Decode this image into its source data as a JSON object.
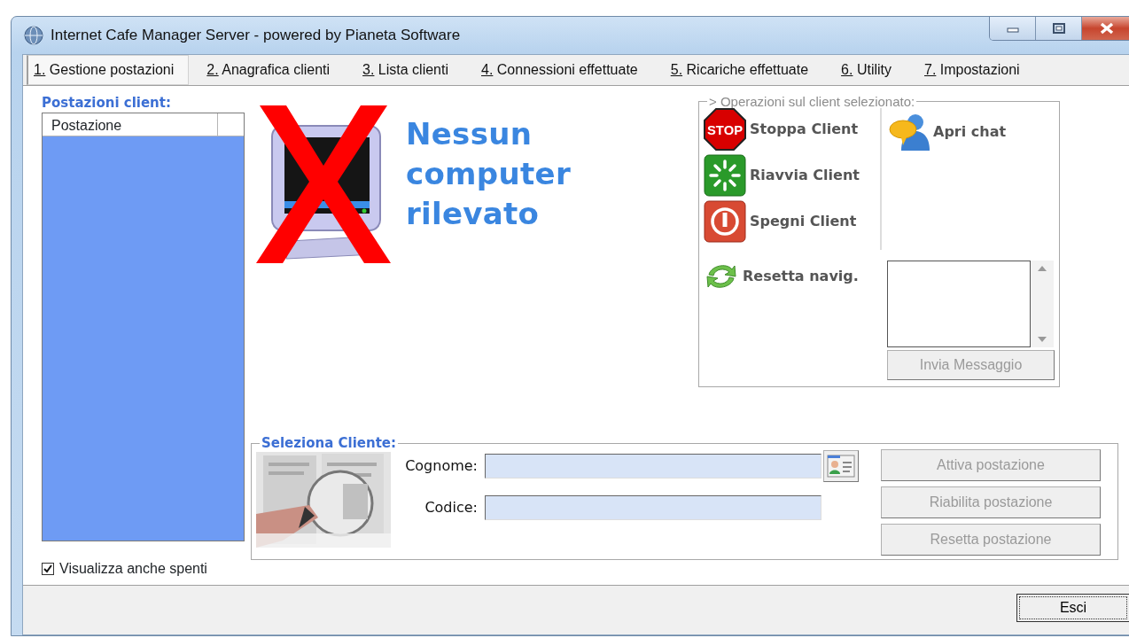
{
  "window": {
    "title": "Internet Cafe Manager Server - powered by Pianeta Software"
  },
  "menu_tabs": [
    {
      "label": "1. Gestione postazioni",
      "selected": true
    },
    {
      "label": "2. Anagrafica clienti",
      "selected": false
    },
    {
      "label": "3. Lista clienti",
      "selected": false
    },
    {
      "label": "4. Connessioni effettuate",
      "selected": false
    },
    {
      "label": "5. Ricariche effettuate",
      "selected": false
    },
    {
      "label": "6. Utility",
      "selected": false
    },
    {
      "label": "7. Impostazioni",
      "selected": false
    }
  ],
  "client_list": {
    "title": "Postazioni client:",
    "columns": [
      "Postazione"
    ]
  },
  "show_off_checkbox": {
    "label": "Visualizza anche spenti",
    "checked": true
  },
  "status_message": "Nessun computer rilevato",
  "operations": {
    "legend": "> Operazioni sul client selezionato:",
    "actions": [
      {
        "label": "Stoppa Client",
        "kind": "stop",
        "icon_text": "STOP"
      },
      {
        "label": "Riavvia Client",
        "kind": "restart"
      },
      {
        "label": "Spegni Client",
        "kind": "shutdown"
      },
      {
        "label": "Resetta navig.",
        "kind": "reset"
      }
    ],
    "chat": {
      "label": "Apri chat"
    },
    "send_button": {
      "label": "Invia Messaggio",
      "disabled": true
    }
  },
  "select_client": {
    "legend": "Seleziona Cliente:",
    "fields": [
      {
        "label": "Cognome:"
      },
      {
        "label": "Codice:"
      }
    ],
    "buttons": [
      {
        "label": "Attiva postazione",
        "disabled": true
      },
      {
        "label": "Riabilita postazione",
        "disabled": true
      },
      {
        "label": "Resetta postazione",
        "disabled": true
      }
    ]
  },
  "exit_button": {
    "label": "Esci"
  }
}
